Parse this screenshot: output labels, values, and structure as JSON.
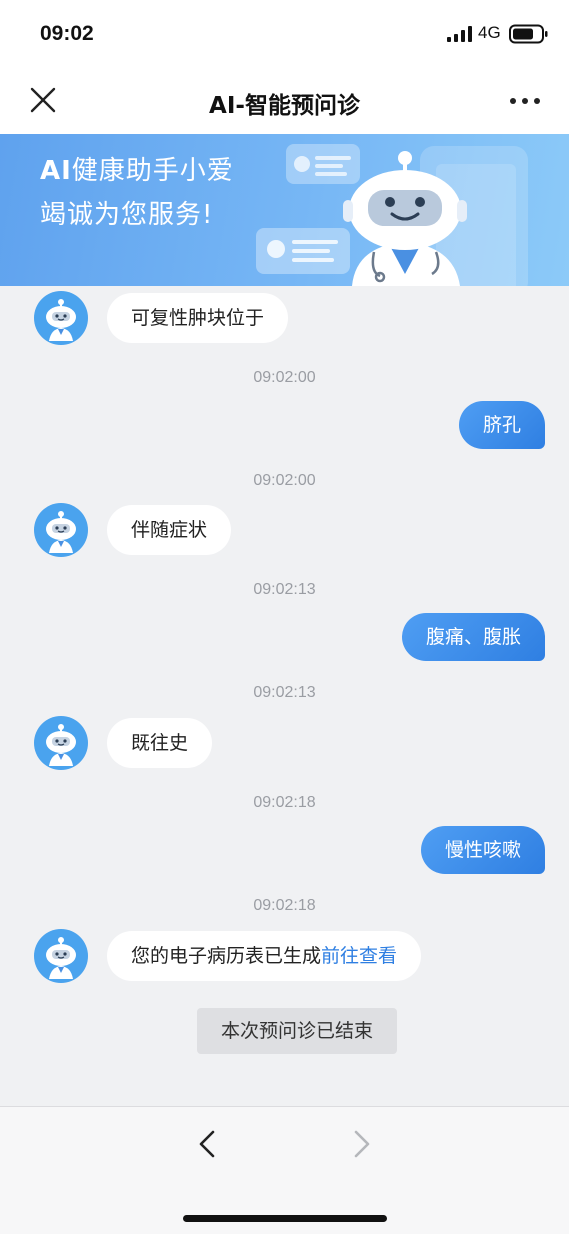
{
  "status_bar": {
    "time": "09:02",
    "network": "4G",
    "icons": [
      "signal-icon",
      "battery-icon"
    ]
  },
  "nav": {
    "title": "AI-智能预问诊",
    "icons": [
      "close-icon",
      "more-icon"
    ]
  },
  "banner": {
    "line1_ai": "AI",
    "line1_rest": "健康助手小爱",
    "line2": "竭诚为您服务!"
  },
  "chat": {
    "messages": [
      {
        "from": "bot",
        "text": "可复性肿块位于"
      },
      {
        "time": "09:02:00"
      },
      {
        "from": "user",
        "text": "脐孔"
      },
      {
        "time": "09:02:00"
      },
      {
        "from": "bot",
        "text": "伴随症状"
      },
      {
        "time": "09:02:13"
      },
      {
        "from": "user",
        "text": "腹痛、腹胀"
      },
      {
        "time": "09:02:13"
      },
      {
        "from": "bot",
        "text": "既往史"
      },
      {
        "time": "09:02:18"
      },
      {
        "from": "user",
        "text": "慢性咳嗽"
      },
      {
        "time": "09:02:18"
      },
      {
        "from": "bot",
        "text": "您的电子病历表已生成",
        "link": "前往查看"
      }
    ],
    "end_notice": "本次预问诊已结束"
  },
  "bottom_bar": {
    "icons": [
      "back-icon",
      "forward-icon"
    ]
  },
  "colors": {
    "accent": "#2f7fe2",
    "background": "#f0f1f3",
    "banner": "#6aaef2"
  }
}
